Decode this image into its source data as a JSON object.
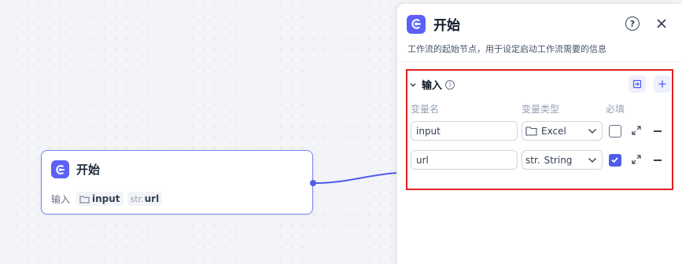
{
  "node": {
    "title": "开始",
    "inputs_label": "输入",
    "vars": [
      {
        "type_prefix": "",
        "name": "input",
        "icon": "folder-icon"
      },
      {
        "type_prefix": "str.",
        "name": "url"
      }
    ]
  },
  "panel": {
    "title": "开始",
    "help": "?",
    "description": "工作流的起始节点，用于设定启动工作流需要的信息",
    "section": {
      "title": "输入",
      "columns": {
        "name": "变量名",
        "type": "变量类型",
        "required": "必填"
      },
      "rows": [
        {
          "name": "input",
          "type_prefix": "",
          "type": "Excel",
          "type_icon": "folder-icon",
          "required": false
        },
        {
          "name": "url",
          "type_prefix": "str.",
          "type": "String",
          "required": true
        }
      ]
    }
  },
  "colors": {
    "accent": "#5b61f6",
    "highlight": "#e02020",
    "edge": "#4e5ce8"
  }
}
